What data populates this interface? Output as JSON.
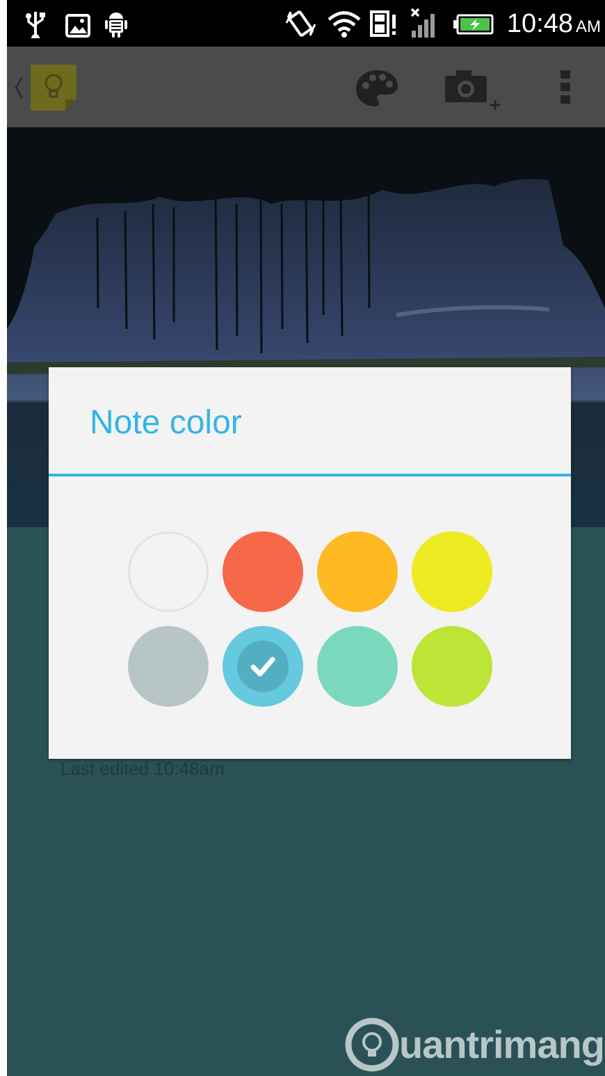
{
  "status_bar": {
    "time": "10:48",
    "ampm": "AM",
    "icons": [
      "usb-icon",
      "picture-icon",
      "android-debug-icon",
      "vibrate-icon",
      "wifi-icon",
      "sd-card-icon",
      "signal-icon",
      "battery-charging-icon"
    ]
  },
  "action_bar": {
    "icons": [
      "back-chevron-icon",
      "keep-app-icon",
      "palette-icon",
      "add-camera-icon",
      "overflow-menu-icon"
    ]
  },
  "note": {
    "last_edited": "Last edited 10:48am"
  },
  "dialog": {
    "title": "Note color",
    "colors": [
      {
        "name": "white",
        "hex": "#f3f3f3",
        "selected": false
      },
      {
        "name": "red",
        "hex": "#f76848",
        "selected": false
      },
      {
        "name": "orange",
        "hex": "#feb923",
        "selected": false
      },
      {
        "name": "yellow",
        "hex": "#eeeb22",
        "selected": false
      },
      {
        "name": "gray",
        "hex": "#b8c5c6",
        "selected": false
      },
      {
        "name": "blue",
        "hex": "#65c9e0",
        "selected": true
      },
      {
        "name": "teal",
        "hex": "#7ad9bd",
        "selected": false
      },
      {
        "name": "green",
        "hex": "#bde537",
        "selected": false
      }
    ],
    "accent": "#33b5e5"
  },
  "watermark": {
    "text": "uantrimang"
  }
}
